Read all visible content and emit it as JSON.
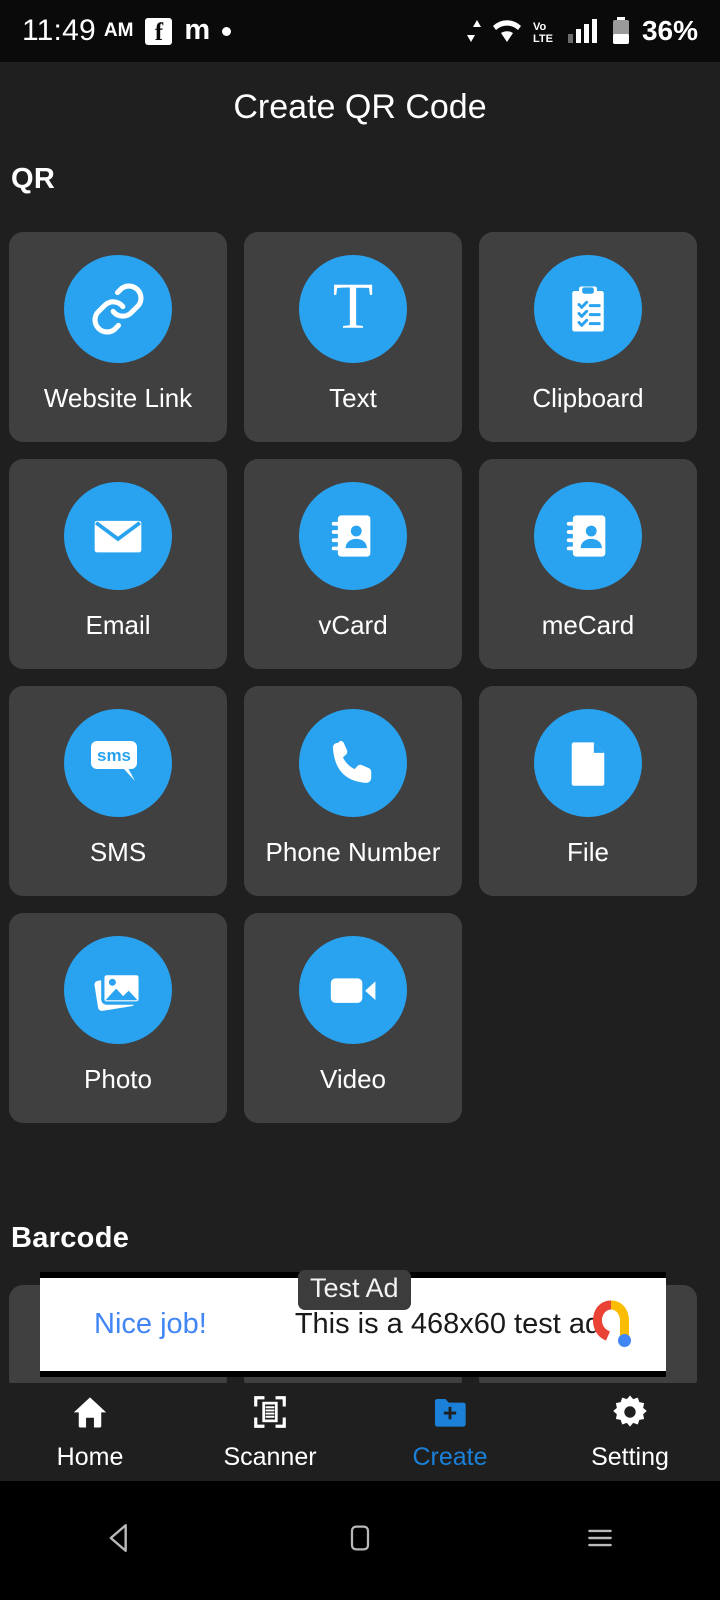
{
  "status_bar": {
    "time": "11:49",
    "ampm": "AM",
    "facebook_letter": "f",
    "mastodon_letter": "m",
    "battery_percent": "36%",
    "icons": [
      "facebook-icon",
      "mastodon-icon",
      "dot-icon",
      "data-transfer-icon",
      "wifi-icon",
      "volte-icon",
      "signal-icon",
      "battery-icon"
    ]
  },
  "header": {
    "title": "Create QR Code"
  },
  "sections": {
    "qr": {
      "heading": "QR"
    },
    "barcode": {
      "heading": "Barcode"
    }
  },
  "qr_items": [
    {
      "label": "Website Link",
      "icon": "link-icon"
    },
    {
      "label": "Text",
      "icon": "text-icon"
    },
    {
      "label": "Clipboard",
      "icon": "clipboard-icon"
    },
    {
      "label": "Email",
      "icon": "email-icon"
    },
    {
      "label": "vCard",
      "icon": "contact-book-icon"
    },
    {
      "label": "meCard",
      "icon": "contact-book-icon"
    },
    {
      "label": "SMS",
      "icon": "sms-icon"
    },
    {
      "label": "Phone Number",
      "icon": "phone-icon"
    },
    {
      "label": "File",
      "icon": "file-icon"
    },
    {
      "label": "Photo",
      "icon": "photo-icon"
    },
    {
      "label": "Video",
      "icon": "video-icon"
    }
  ],
  "sms_icon_word": "sms",
  "text_icon_glyph": "T",
  "ad": {
    "badge": "Test Ad",
    "link_text": "Nice job!",
    "body_text": "This is a 468x60 test ad.",
    "logo": "admob-logo"
  },
  "bottom_nav": [
    {
      "label": "Home",
      "icon": "home-icon",
      "active": false
    },
    {
      "label": "Scanner",
      "icon": "scanner-icon",
      "active": false
    },
    {
      "label": "Create",
      "icon": "create-folder-icon",
      "active": true
    },
    {
      "label": "Setting",
      "icon": "gear-icon",
      "active": false
    }
  ],
  "android_nav": [
    {
      "name": "back-button",
      "icon": "triangle-back-icon"
    },
    {
      "name": "home-button",
      "icon": "square-home-icon"
    },
    {
      "name": "recents-button",
      "icon": "menu-recents-icon"
    }
  ],
  "colors": {
    "accent_blue": "#29a3ef",
    "active_nav_blue": "#1a80d8",
    "card_bg": "#404040",
    "page_bg": "#1f1f1f",
    "ad_link_blue": "#4285f4"
  }
}
